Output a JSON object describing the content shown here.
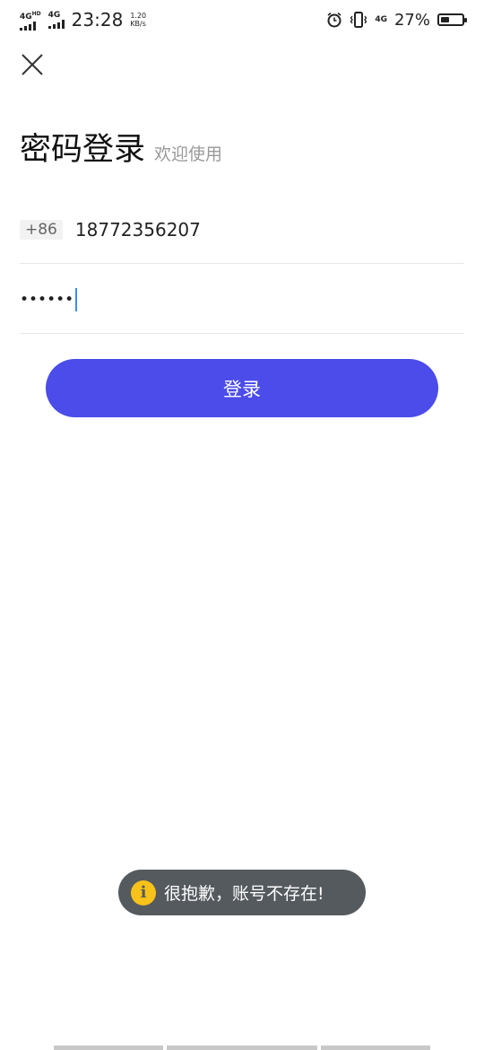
{
  "status_bar": {
    "network_1": "4G",
    "network_1_sup": "HD",
    "network_2": "4G",
    "time": "23:28",
    "speed_value": "1.20",
    "speed_unit": "KB/s",
    "network_3": "4G",
    "battery": "27%",
    "battery_level": 0.27
  },
  "header": {
    "title": "密码登录",
    "subtitle": "欢迎使用"
  },
  "phone": {
    "country_code": "+86",
    "value": "18772356207"
  },
  "password": {
    "value": "••••••"
  },
  "login_button": {
    "label": "登录"
  },
  "toast": {
    "icon": "info-icon",
    "icon_glyph": "i",
    "message": "很抱歉，账号不存在!"
  },
  "colors": {
    "primary": "#4b4ce9",
    "toast_bg": "#555a5f",
    "toast_icon": "#f7c21a",
    "cursor": "#3a8ef6"
  }
}
